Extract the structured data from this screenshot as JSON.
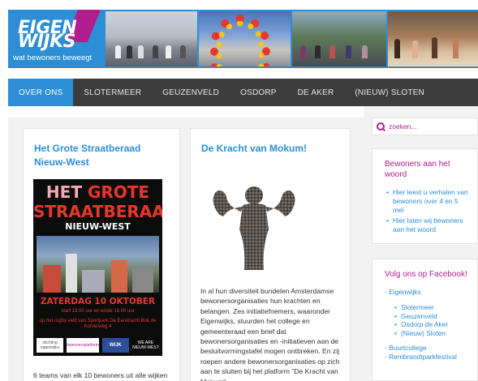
{
  "logo": {
    "line1": "EIGEN",
    "line2": "WIJKS",
    "tagline": "wat bewoners beweegt"
  },
  "nav": {
    "items": [
      "OVER ONS",
      "SLOTERMEER",
      "GEUZENVELD",
      "OSDORP",
      "DE AKER",
      "(NIEUW) SLOTEN"
    ],
    "active_index": 0
  },
  "posts": [
    {
      "title": "Het Grote Straatberaad Nieuw-West",
      "excerpt": "6 teams van elk 10 bewoners uit alle wijken",
      "poster": {
        "line1a": "HET ",
        "line1b": "GROTE",
        "line2": "STRAATBERAAD",
        "line3": "NIEUW-WEST",
        "date": "ZATERDAG 10 OKTOBER",
        "time": "start 13.00 uur en einde 18.00 uur",
        "venue": "op het rugby veld van Sportpark De Eendracht Bok de Korverweg 4",
        "sponsor1": "stichting eigenwijks",
        "sponsor2": "bewonersplatform",
        "sponsor3": "WIJK",
        "sponsor4": "WE ARE NIEUW-WEST"
      }
    },
    {
      "title": "De Kracht van Mokum!",
      "excerpt": "In al hun diversiteit bundelen Amsterdamse bewonersorganisaties hun krachten en belangen. Zes initiatiefnemers, waaronder Eigenwijks, stuurden het college en gemeenteraad een brief dat bewonersorganisaties en -initiatieven aan de besluitvormingstafel mogen ontbreken. En zij roepen andere bewonersorganisaties op zich aan te sluiten bij het platform \"De Kracht van Mokum\"."
    }
  ],
  "search": {
    "placeholder": "zoeken..."
  },
  "widgets": {
    "bewoners": {
      "title": "Bewoners aan het woord",
      "items": [
        "Hier leest u verhalen van bewoners over 4 en 5 mei",
        "Hier laten wij bewoners aan het woord"
      ]
    },
    "facebook": {
      "title": "Volg ons op Facebook!",
      "main_link": "- Eigenwijks",
      "sub_items": [
        "Slotermeer",
        "Geuzenveld",
        "Osdorp de Aker",
        "(Nieuw) Sloten"
      ],
      "link2": "- Buurtcollege",
      "link3": "- Rembrandtparkfestival"
    }
  },
  "colors": {
    "brand_blue": "#2c8fd6",
    "brand_magenta": "#b01e8e",
    "nav_bg": "#3d3d3d"
  }
}
